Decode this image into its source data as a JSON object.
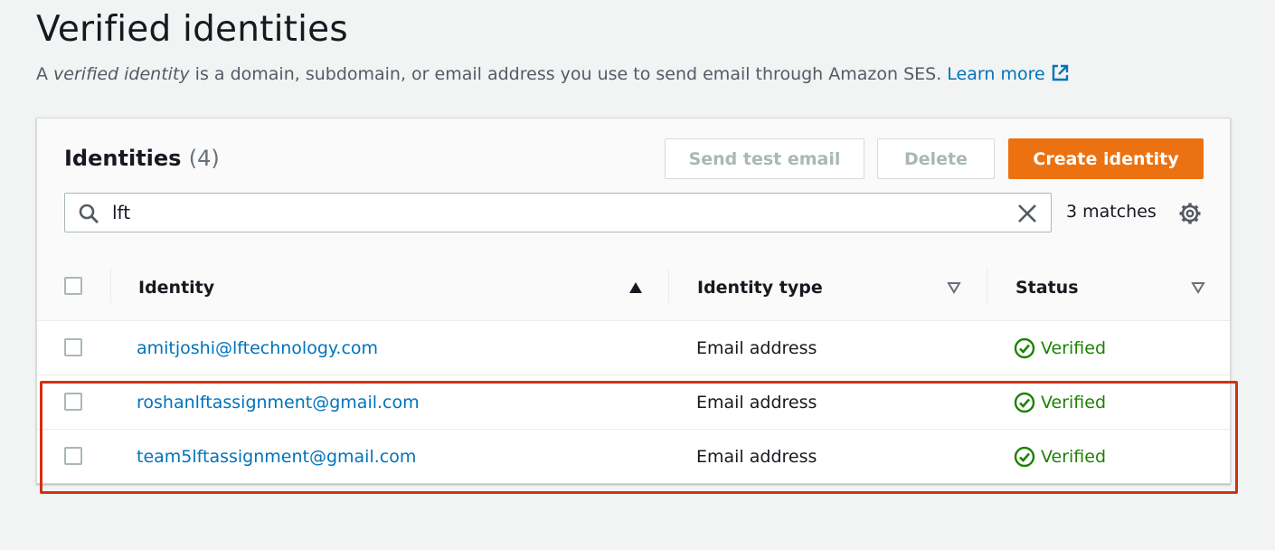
{
  "page": {
    "title": "Verified identities",
    "desc_prefix": "A ",
    "desc_emphasis": "verified identity",
    "desc_suffix": " is a domain, subdomain, or email address you use to send email through Amazon SES. ",
    "learn_more": "Learn more"
  },
  "panel": {
    "title": "Identities",
    "count": "(4)",
    "buttons": {
      "send_test_email": "Send test email",
      "delete": "Delete",
      "create_identity": "Create identity"
    },
    "search": {
      "value": "lft",
      "matches": "3 matches"
    },
    "columns": {
      "identity": "Identity",
      "identity_type": "Identity type",
      "status": "Status"
    },
    "rows": [
      {
        "identity": "amitjoshi@lftechnology.com",
        "type": "Email address",
        "status": "Verified"
      },
      {
        "identity": "roshanlftassignment@gmail.com",
        "type": "Email address",
        "status": "Verified"
      },
      {
        "identity": "team5lftassignment@gmail.com",
        "type": "Email address",
        "status": "Verified"
      }
    ]
  },
  "colors": {
    "accent": "#ec7211",
    "link": "#0073bb",
    "success": "#1d8102",
    "highlight": "#d13212"
  },
  "icons": {
    "search": "search-icon",
    "clear": "close-icon",
    "settings": "gear-icon",
    "external": "external-link-icon",
    "status": "check-circle-icon"
  }
}
